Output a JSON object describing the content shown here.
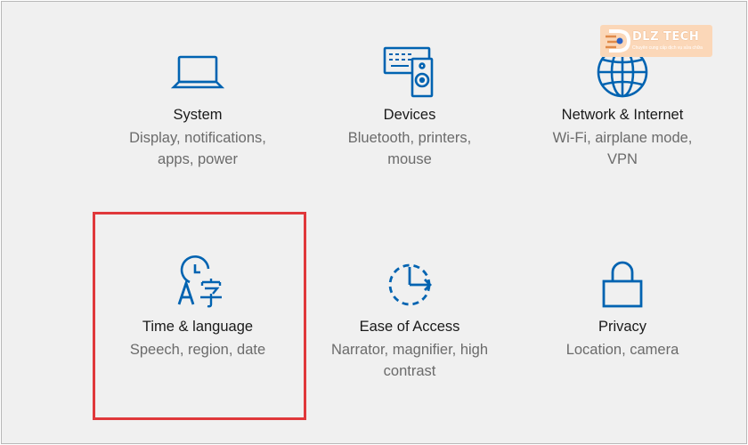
{
  "settings_tiles": [
    {
      "title": "System",
      "description": "Display, notifications, apps, power",
      "icon": "laptop-icon"
    },
    {
      "title": "Devices",
      "description": "Bluetooth, printers, mouse",
      "icon": "devices-icon"
    },
    {
      "title": "Network & Internet",
      "description": "Wi-Fi, airplane mode, VPN",
      "icon": "globe-icon"
    },
    {
      "title": "Time & language",
      "description": "Speech, region, date",
      "icon": "time-language-icon"
    },
    {
      "title": "Ease of Access",
      "description": "Narrator, magnifier, high contrast",
      "icon": "ease-of-access-icon"
    },
    {
      "title": "Privacy",
      "description": "Location, camera",
      "icon": "lock-icon"
    }
  ],
  "watermark": {
    "brand": "DLZ TECH",
    "tagline": "Chuyên cung cấp dịch vụ sửa chữa"
  },
  "colors": {
    "accent": "#0063b1",
    "highlight": "#e0383b",
    "background": "#f0f0f0",
    "title_text": "#1a1a1a",
    "description_text": "#6b6b6b",
    "watermark_bg": "#fbd7b8"
  }
}
